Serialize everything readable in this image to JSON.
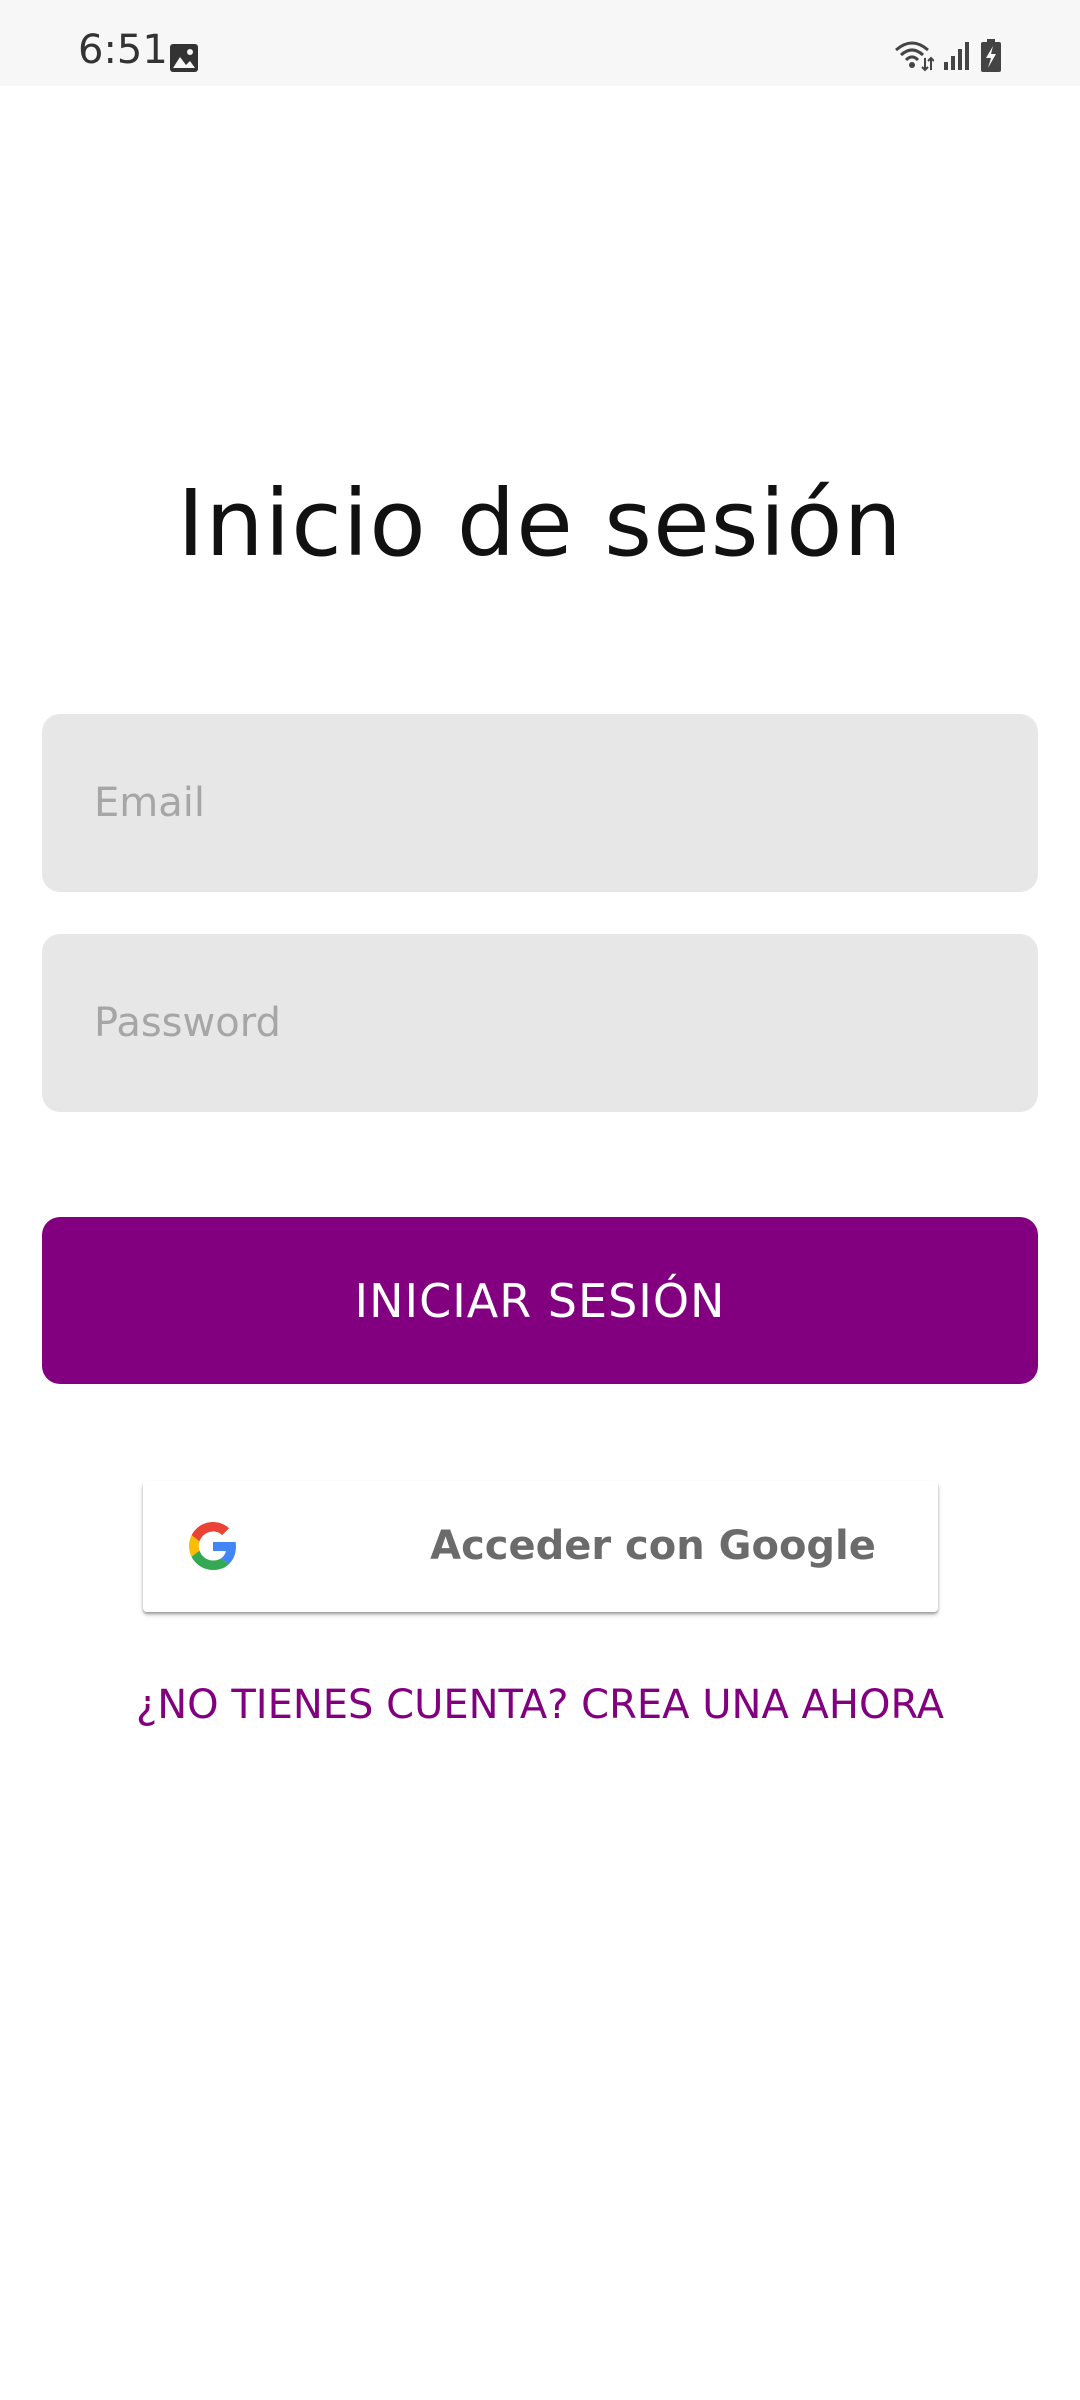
{
  "status_bar": {
    "time": "6:51",
    "icons": [
      "gallery-icon",
      "wifi-icon",
      "signal-icon",
      "battery-charging-icon"
    ]
  },
  "login": {
    "title": "Inicio de sesión",
    "email": {
      "value": "",
      "placeholder": "Email"
    },
    "password": {
      "value": "",
      "placeholder": "Password"
    },
    "submit_label": "INICIAR SESIÓN",
    "google_label": "Acceder con Google",
    "signup_link": "¿NO TIENES CUENTA? CREA UNA AHORA"
  },
  "colors": {
    "accent": "#820080",
    "field_background": "#e7e7e7",
    "status_bar": "#f7f7f7"
  }
}
